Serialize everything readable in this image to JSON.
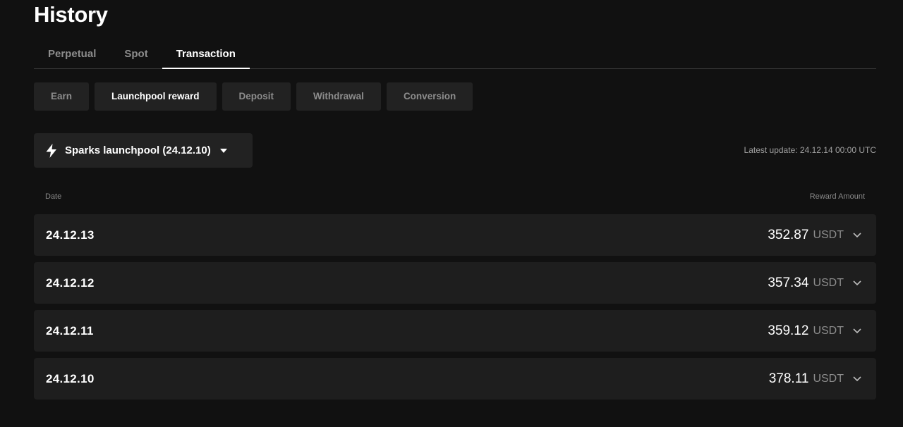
{
  "page": {
    "title": "History"
  },
  "tabs": [
    {
      "label": "Perpetual",
      "active": false
    },
    {
      "label": "Spot",
      "active": false
    },
    {
      "label": "Transaction",
      "active": true
    }
  ],
  "filters": [
    {
      "label": "Earn",
      "active": false
    },
    {
      "label": "Launchpool reward",
      "active": true
    },
    {
      "label": "Deposit",
      "active": false
    },
    {
      "label": "Withdrawal",
      "active": false
    },
    {
      "label": "Conversion",
      "active": false
    }
  ],
  "pool_selector": {
    "icon": "bolt-icon",
    "label": "Sparks launchpool (24.12.10)",
    "caret_icon": "caret-down-icon"
  },
  "latest_update": {
    "prefix": "Latest update:",
    "value": "24.12.14 00:00 UTC"
  },
  "table": {
    "columns": {
      "date": "Date",
      "amount": "Reward Amount"
    },
    "rows": [
      {
        "date": "24.12.13",
        "amount": "352.87",
        "unit": "USDT"
      },
      {
        "date": "24.12.12",
        "amount": "357.34",
        "unit": "USDT"
      },
      {
        "date": "24.12.11",
        "amount": "359.12",
        "unit": "USDT"
      },
      {
        "date": "24.12.10",
        "amount": "378.11",
        "unit": "USDT"
      }
    ]
  },
  "colors": {
    "background": "#111111",
    "surface": "#1e1e1e",
    "chip": "#222222",
    "text_primary": "#ffffff",
    "text_muted": "#8d8d8d"
  }
}
